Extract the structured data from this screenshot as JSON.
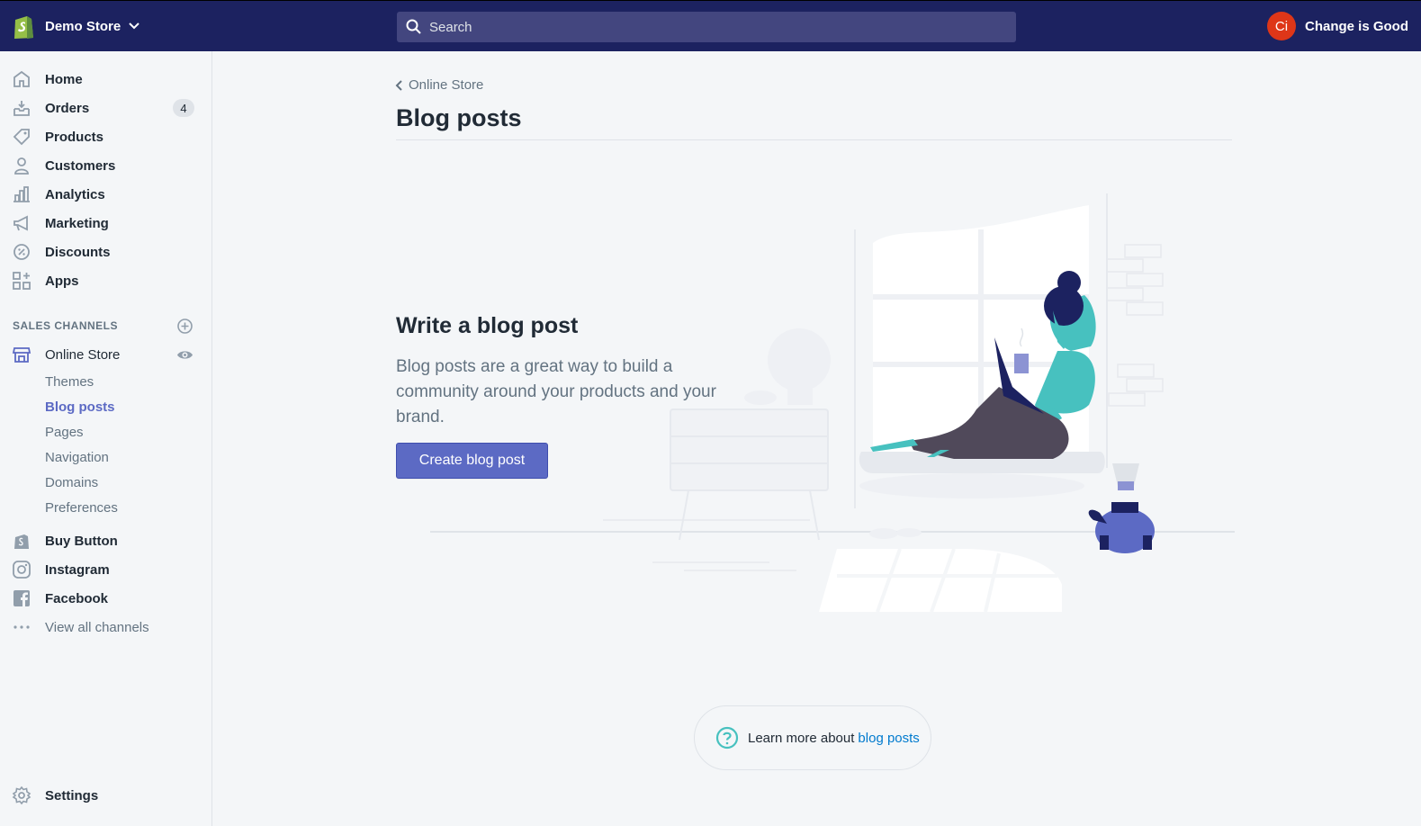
{
  "topbar": {
    "store_name": "Demo Store",
    "search_placeholder": "Search",
    "avatar_initials": "Ci",
    "user_name": "Change is Good"
  },
  "sidebar": {
    "items": [
      {
        "label": "Home",
        "icon": "home-icon"
      },
      {
        "label": "Orders",
        "icon": "orders-icon",
        "badge": "4"
      },
      {
        "label": "Products",
        "icon": "tag-icon"
      },
      {
        "label": "Customers",
        "icon": "person-icon"
      },
      {
        "label": "Analytics",
        "icon": "bar-chart-icon"
      },
      {
        "label": "Marketing",
        "icon": "megaphone-icon"
      },
      {
        "label": "Discounts",
        "icon": "discount-icon"
      },
      {
        "label": "Apps",
        "icon": "apps-icon"
      }
    ],
    "sales_channels_heading": "SALES CHANNELS",
    "online_store": {
      "label": "Online Store",
      "sub_items": [
        "Themes",
        "Blog posts",
        "Pages",
        "Navigation",
        "Domains",
        "Preferences"
      ],
      "active": "Blog posts"
    },
    "channels": [
      {
        "label": "Buy Button",
        "icon": "buy-button-icon"
      },
      {
        "label": "Instagram",
        "icon": "instagram-icon"
      },
      {
        "label": "Facebook",
        "icon": "facebook-icon"
      }
    ],
    "view_all": "View all channels",
    "settings": "Settings"
  },
  "main": {
    "breadcrumb": "Online Store",
    "title": "Blog posts",
    "empty_state": {
      "heading": "Write a blog post",
      "body": "Blog posts are a great way to build a community around your products and your brand.",
      "button": "Create blog post"
    },
    "footer_help": {
      "text": "Learn more about",
      "link": "blog posts"
    }
  },
  "colors": {
    "topbar": "#1c2260",
    "search_bg": "#43467f",
    "accent": "#5c6ac4",
    "avatar": "#de3618",
    "link": "#007ace",
    "teal": "#47c1bf"
  }
}
